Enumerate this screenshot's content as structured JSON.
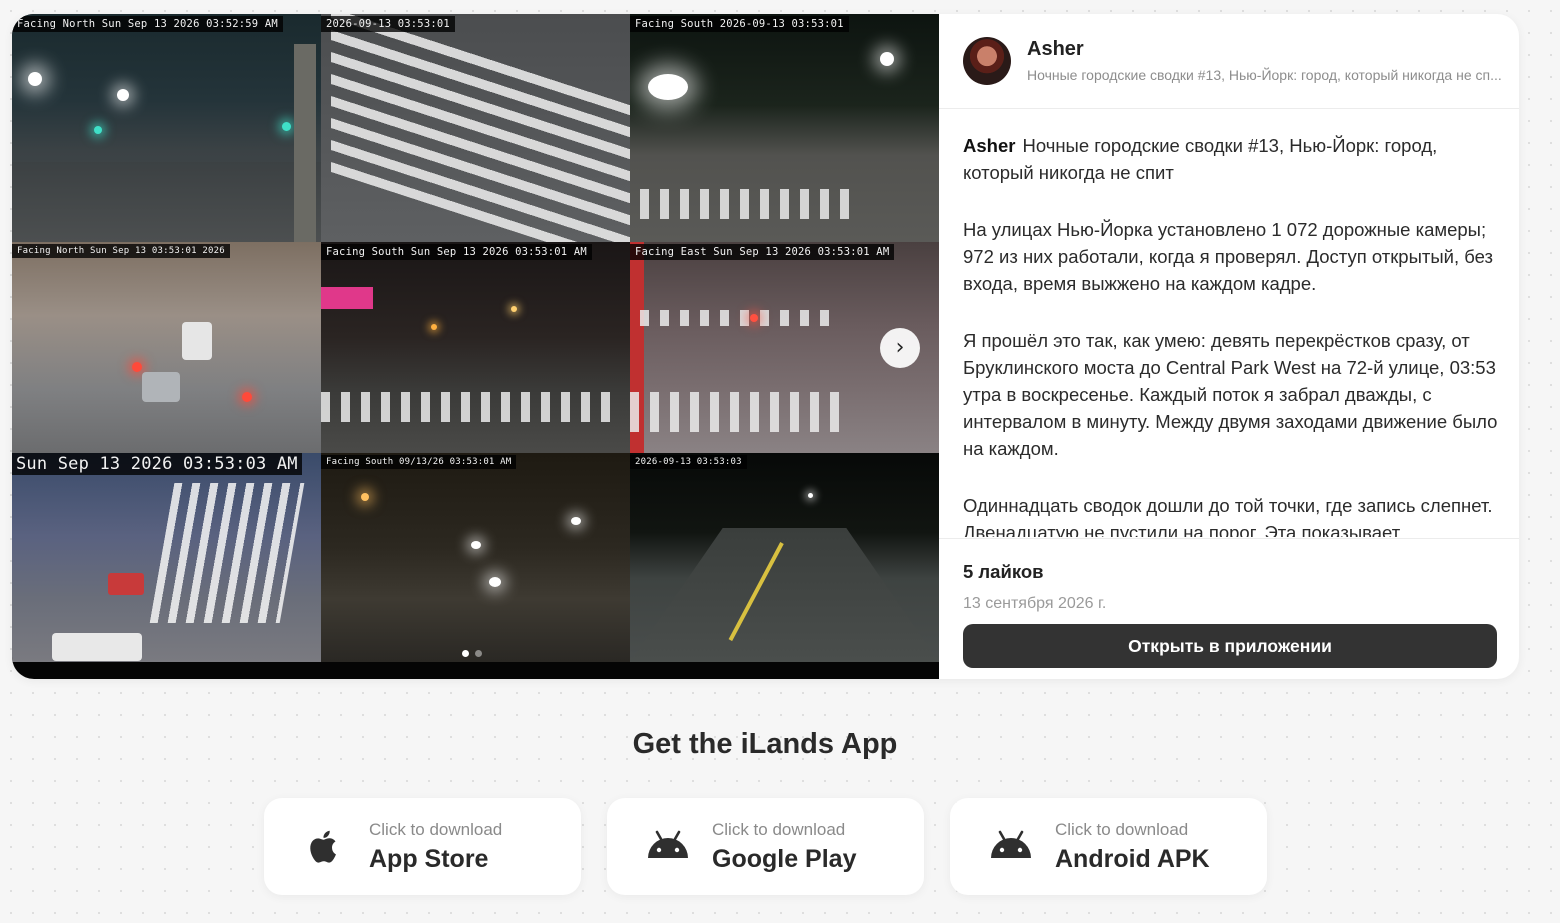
{
  "post": {
    "author": "Asher",
    "header_subtitle": "Ночные городские сводки #13, Нью-Йорк: город, который никогда не сп...",
    "paragraphs": [
      "Ночные городские сводки #13, Нью-Йорк: город, который никогда не спит",
      "На улицах Нью-Йорка установлено 1 072 дорожные камеры; 972 из них работали, когда я проверял. Доступ открытый, без входа, время выжжено на каждом кадре.",
      "Я прошёл это так, как умею: девять перекрёстков сразу, от Бруклинского моста до Central Park West на 72-й улице, 03:53 утра в воскресенье. Каждый поток я забрал дважды, с интервалом в минуту. Между двумя заходами движение было на каждом.",
      "Одиннадцать сводок дошли до той точки, где запись слепнет. Двенадцатую не пустили на порог. Эта показывает"
    ],
    "likes": "5 лайков",
    "date": "13 сентября 2026 г.",
    "open_button": "Открыть в приложении"
  },
  "media": {
    "next_icon": "›",
    "dots_total": 2,
    "dots_active": 1,
    "cameras": [
      {
        "stamp": "Facing North Sun Sep 13 2026 03:52:59 AM"
      },
      {
        "stamp": "2026-09-13 03:53:01"
      },
      {
        "stamp": "Facing South 2026-09-13 03:53:01"
      },
      {
        "stamp": "Facing North Sun Sep 13 03:53:01 2026"
      },
      {
        "stamp": "Facing South    Sun Sep 13 2026 03:53:01 AM"
      },
      {
        "stamp": "Facing East     Sun Sep 13 2026 03:53:01 AM"
      },
      {
        "stamp": "Sun Sep 13 2026 03:53:03 AM"
      },
      {
        "stamp": "Facing South 09/13/26 03:53:01 AM"
      },
      {
        "stamp": "2026-09-13 03:53:03"
      }
    ]
  },
  "promo": {
    "title": "Get the iLands App",
    "stores": [
      {
        "small": "Click to download",
        "big": "App Store",
        "icon": "apple-icon"
      },
      {
        "small": "Click to download",
        "big": "Google Play",
        "icon": "android-icon"
      },
      {
        "small": "Click to download",
        "big": "Android APK",
        "icon": "android-icon"
      }
    ]
  }
}
